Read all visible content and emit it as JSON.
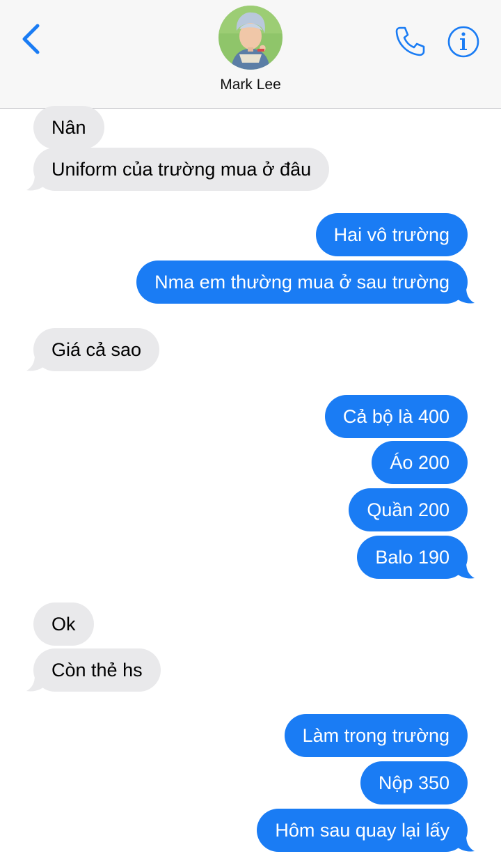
{
  "header": {
    "back_icon": "chevron-left-icon",
    "contact_name": "Mark Lee",
    "call_icon": "phone-icon",
    "info_icon": "info-icon",
    "accent_color": "#1a7cf4"
  },
  "messages": [
    {
      "direction": "in",
      "text": "Nân"
    },
    {
      "direction": "in",
      "text": "Uniform của trường mua ở đâu"
    },
    {
      "direction": "out",
      "text": "Hai vô trường"
    },
    {
      "direction": "out",
      "text": "Nma em thường mua ở sau trường"
    },
    {
      "direction": "in",
      "text": "Giá cả sao"
    },
    {
      "direction": "out",
      "text": "Cả bộ là 400"
    },
    {
      "direction": "out",
      "text": "Áo 200"
    },
    {
      "direction": "out",
      "text": "Quần 200"
    },
    {
      "direction": "out",
      "text": "Balo 190"
    },
    {
      "direction": "in",
      "text": "Ok"
    },
    {
      "direction": "in",
      "text": "Còn thẻ hs"
    },
    {
      "direction": "out",
      "text": "Làm trong trường"
    },
    {
      "direction": "out",
      "text": "Nộp 350"
    },
    {
      "direction": "out",
      "text": "Hôm sau quay lại lấy"
    }
  ],
  "colors": {
    "incoming_bubble": "#e9e9eb",
    "outgoing_bubble": "#1a7cf4"
  }
}
